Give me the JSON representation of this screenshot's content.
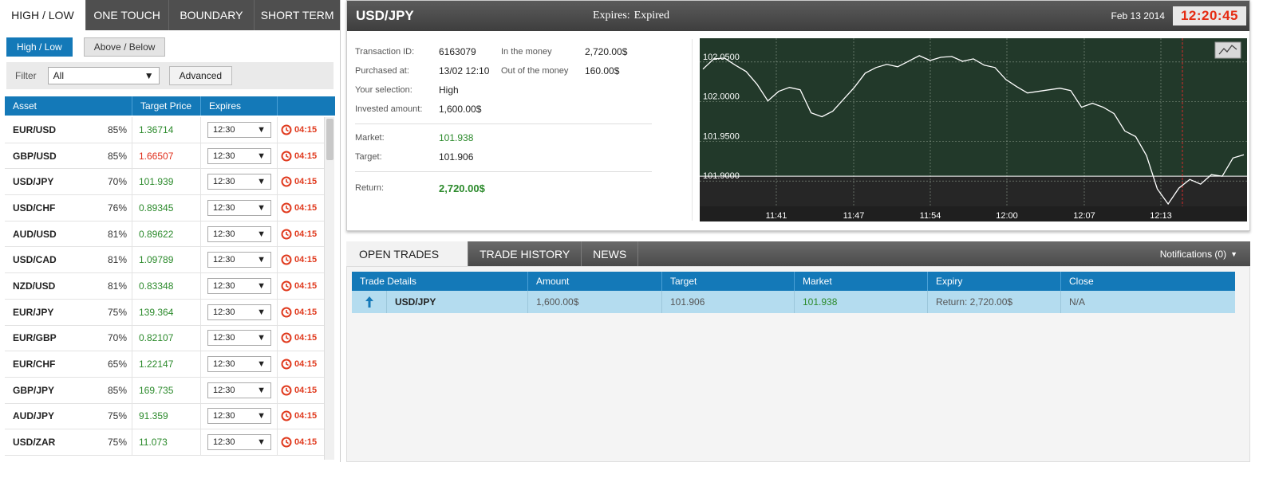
{
  "left_panel": {
    "top_tabs": [
      {
        "label": "HIGH / LOW",
        "active": true
      },
      {
        "label": "ONE TOUCH",
        "active": false
      },
      {
        "label": "BOUNDARY",
        "active": false
      },
      {
        "label": "SHORT TERM",
        "active": false
      }
    ],
    "sub_tabs": [
      {
        "label": "High / Low",
        "active": true
      },
      {
        "label": "Above / Below",
        "active": false
      }
    ],
    "filter": {
      "label": "Filter",
      "value": "All",
      "advanced_label": "Advanced"
    },
    "columns": [
      "Asset",
      "Target Price",
      "Expires"
    ],
    "assets": [
      {
        "name": "EUR/USD",
        "payout": "85%",
        "price": "1.36714",
        "price_dir": "up",
        "expiry": "12:30",
        "countdown": "04:15"
      },
      {
        "name": "GBP/USD",
        "payout": "85%",
        "price": "1.66507",
        "price_dir": "down",
        "expiry": "12:30",
        "countdown": "04:15"
      },
      {
        "name": "USD/JPY",
        "payout": "70%",
        "price": "101.939",
        "price_dir": "up",
        "expiry": "12:30",
        "countdown": "04:15"
      },
      {
        "name": "USD/CHF",
        "payout": "76%",
        "price": "0.89345",
        "price_dir": "up",
        "expiry": "12:30",
        "countdown": "04:15"
      },
      {
        "name": "AUD/USD",
        "payout": "81%",
        "price": "0.89622",
        "price_dir": "up",
        "expiry": "12:30",
        "countdown": "04:15"
      },
      {
        "name": "USD/CAD",
        "payout": "81%",
        "price": "1.09789",
        "price_dir": "up",
        "expiry": "12:30",
        "countdown": "04:15"
      },
      {
        "name": "NZD/USD",
        "payout": "81%",
        "price": "0.83348",
        "price_dir": "up",
        "expiry": "12:30",
        "countdown": "04:15"
      },
      {
        "name": "EUR/JPY",
        "payout": "75%",
        "price": "139.364",
        "price_dir": "up",
        "expiry": "12:30",
        "countdown": "04:15"
      },
      {
        "name": "EUR/GBP",
        "payout": "70%",
        "price": "0.82107",
        "price_dir": "up",
        "expiry": "12:30",
        "countdown": "04:15"
      },
      {
        "name": "EUR/CHF",
        "payout": "65%",
        "price": "1.22147",
        "price_dir": "up",
        "expiry": "12:30",
        "countdown": "04:15"
      },
      {
        "name": "GBP/JPY",
        "payout": "85%",
        "price": "169.735",
        "price_dir": "up",
        "expiry": "12:30",
        "countdown": "04:15"
      },
      {
        "name": "AUD/JPY",
        "payout": "75%",
        "price": "91.359",
        "price_dir": "up",
        "expiry": "12:30",
        "countdown": "04:15"
      },
      {
        "name": "USD/ZAR",
        "payout": "75%",
        "price": "11.073",
        "price_dir": "up",
        "expiry": "12:30",
        "countdown": "04:15"
      }
    ]
  },
  "trade": {
    "title": "USD/JPY",
    "expires_label": "Expires:",
    "expires_value": "Expired",
    "date": "Feb 13 2014",
    "clock": "12:20:45",
    "transaction_id_label": "Transaction ID:",
    "transaction_id": "6163079",
    "purchased_label": "Purchased at:",
    "purchased": "13/02 12:10",
    "selection_label": "Your selection:",
    "selection": "High",
    "invested_label": "Invested amount:",
    "invested": "1,600.00$",
    "in_money_label": "In the money",
    "in_money": "2,720.00$",
    "out_money_label": "Out of the money",
    "out_money": "160.00$",
    "market_label": "Market:",
    "market": "101.938",
    "target_label": "Target:",
    "target": "101.906",
    "return_label": "Return:",
    "return": "2,720.00$"
  },
  "chart_data": {
    "type": "line",
    "title": "",
    "xlabel": "",
    "ylabel": "",
    "x_ticks": [
      "11:41",
      "11:47",
      "11:54",
      "12:00",
      "12:07",
      "12:13"
    ],
    "y_ticks": [
      "102.0500",
      "102.0000",
      "101.9500",
      "101.9000"
    ],
    "ylim": [
      101.868,
      102.08
    ],
    "target_line": 101.906,
    "grid": true,
    "background": "#22392a",
    "line_color": "#ffffff",
    "expiry_marker_color": "#d42a2a",
    "series": [
      {
        "x": [
          0,
          2,
          4,
          6,
          8,
          10,
          12,
          14,
          16,
          18,
          20,
          22,
          24,
          26,
          28,
          30,
          32,
          34,
          36,
          38,
          40,
          42,
          44,
          46,
          48,
          50,
          52,
          54,
          56,
          58,
          60,
          62,
          64,
          66,
          68,
          70,
          72,
          74,
          76,
          78,
          80,
          82,
          84,
          86,
          88,
          90,
          92,
          94,
          96,
          98,
          100
        ],
        "y": [
          102.041,
          102.054,
          102.055,
          102.046,
          102.038,
          102.022,
          102.001,
          102.013,
          102.018,
          102.015,
          101.986,
          101.981,
          101.988,
          102.003,
          102.018,
          102.036,
          102.043,
          102.047,
          102.044,
          102.051,
          102.058,
          102.052,
          102.056,
          102.057,
          102.051,
          102.054,
          102.046,
          102.043,
          102.028,
          102.019,
          102.011,
          102.013,
          102.015,
          102.017,
          102.014,
          101.993,
          101.998,
          101.993,
          101.985,
          101.963,
          101.956,
          101.932,
          101.89,
          101.871,
          101.891,
          101.902,
          101.896,
          101.908,
          101.906,
          101.929,
          101.933
        ]
      }
    ]
  },
  "open_trades": {
    "tabs": [
      {
        "label": "OPEN TRADES",
        "active": true
      },
      {
        "label": "TRADE HISTORY",
        "active": false
      },
      {
        "label": "NEWS",
        "active": false
      }
    ],
    "notifications": "Notifications (0)",
    "columns": [
      "Trade Details",
      "Amount",
      "Target",
      "Market",
      "Expiry",
      "Close"
    ],
    "rows": [
      {
        "direction": "up",
        "asset": "USD/JPY",
        "amount": "1,600.00$",
        "target": "101.906",
        "market": "101.938",
        "expiry": "Return: 2,720.00$",
        "close": "N/A"
      }
    ]
  }
}
